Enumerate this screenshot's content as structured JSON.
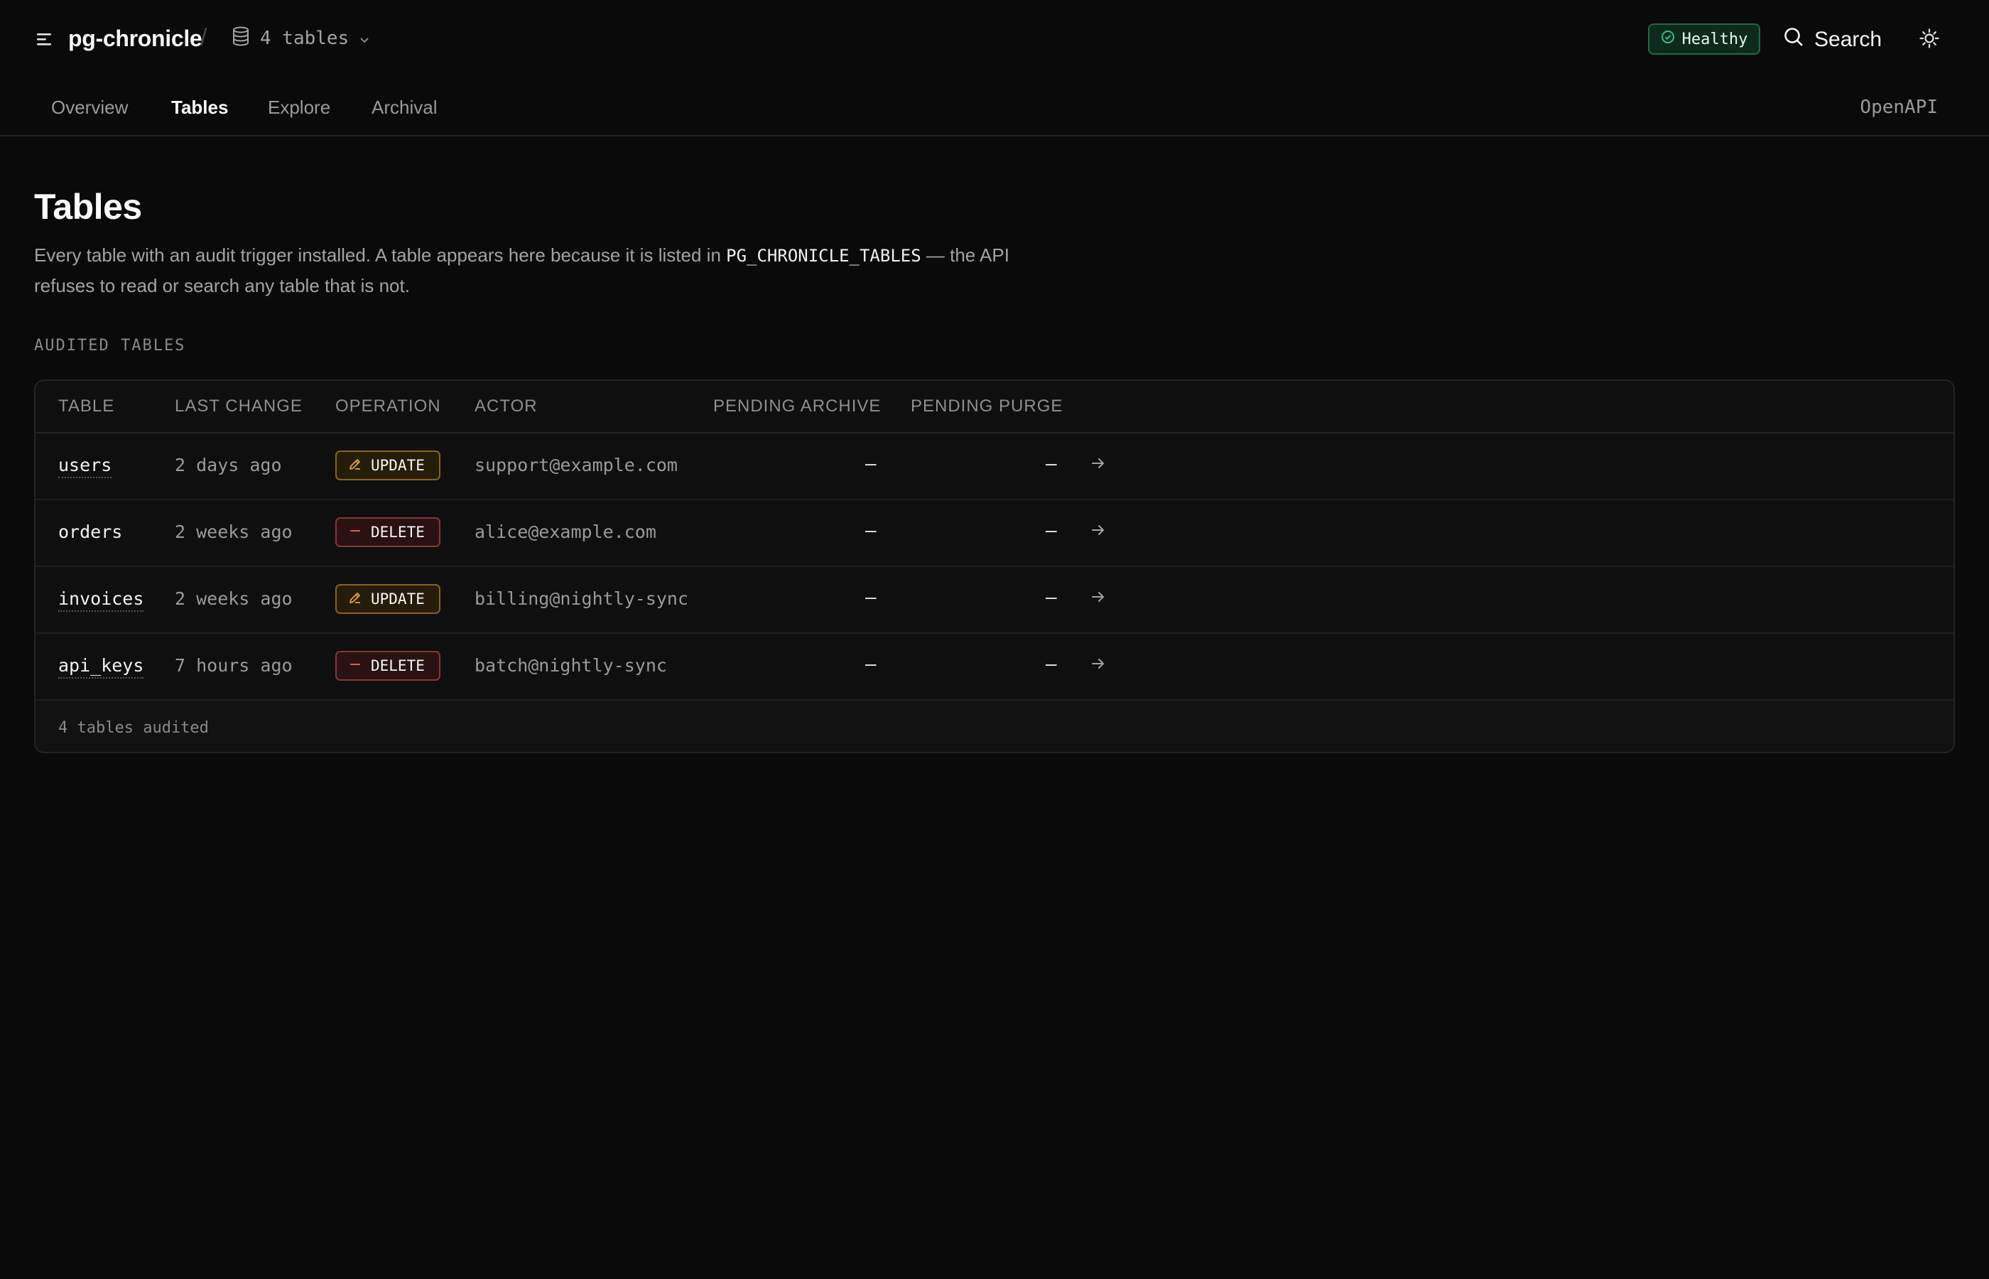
{
  "header": {
    "app_name": "pg-chronicle",
    "separator": "/",
    "database_selector": "4 tables",
    "status_badge": "Healthy",
    "search_label": "Search",
    "icons": {
      "menu": "menu-icon",
      "database": "database-icon",
      "chevron": "chevron-down-icon",
      "status": "check-circle-icon",
      "search": "search-icon",
      "theme": "sun-icon"
    },
    "colors": {
      "healthy_border": "#1f6b45",
      "healthy_icon": "#34c27a"
    }
  },
  "nav": {
    "tabs": [
      {
        "label": "Overview",
        "active": false
      },
      {
        "label": "Tables",
        "active": true
      },
      {
        "label": "Explore",
        "active": false
      },
      {
        "label": "Archival",
        "active": false
      }
    ],
    "right_link": "OpenAPI"
  },
  "main": {
    "title": "Tables",
    "description_part1": "Every table with an audit trigger installed. A table appears here because it is listed in ",
    "description_code": "PG_CHRONICLE_TABLES",
    "description_part2": " — the API refuses to read or search any table that is not.",
    "section_label": "AUDITED TABLES",
    "table": {
      "columns": [
        "TABLE",
        "LAST CHANGE",
        "OPERATION",
        "ACTOR",
        "PENDING ARCHIVE",
        "PENDING PURGE"
      ],
      "rows": [
        {
          "table": "users",
          "last_change": "2 days ago",
          "operation": "UPDATE",
          "actor": "support@example.com",
          "pending_archive": "–",
          "pending_purge": "–"
        },
        {
          "table": "orders",
          "last_change": "2 weeks ago",
          "operation": "DELETE",
          "actor": "alice@example.com",
          "pending_archive": "–",
          "pending_purge": "–"
        },
        {
          "table": "invoices",
          "last_change": "2 weeks ago",
          "operation": "UPDATE",
          "actor": "billing@nightly-sync",
          "pending_archive": "–",
          "pending_purge": "–"
        },
        {
          "table": "api_keys",
          "last_change": "7 hours ago",
          "operation": "DELETE",
          "actor": "batch@nightly-sync",
          "pending_archive": "–",
          "pending_purge": "–"
        }
      ],
      "footer": "4 tables audited"
    },
    "colors": {
      "update_accent": "#e0a43a",
      "delete_accent": "#e05a5a"
    }
  }
}
